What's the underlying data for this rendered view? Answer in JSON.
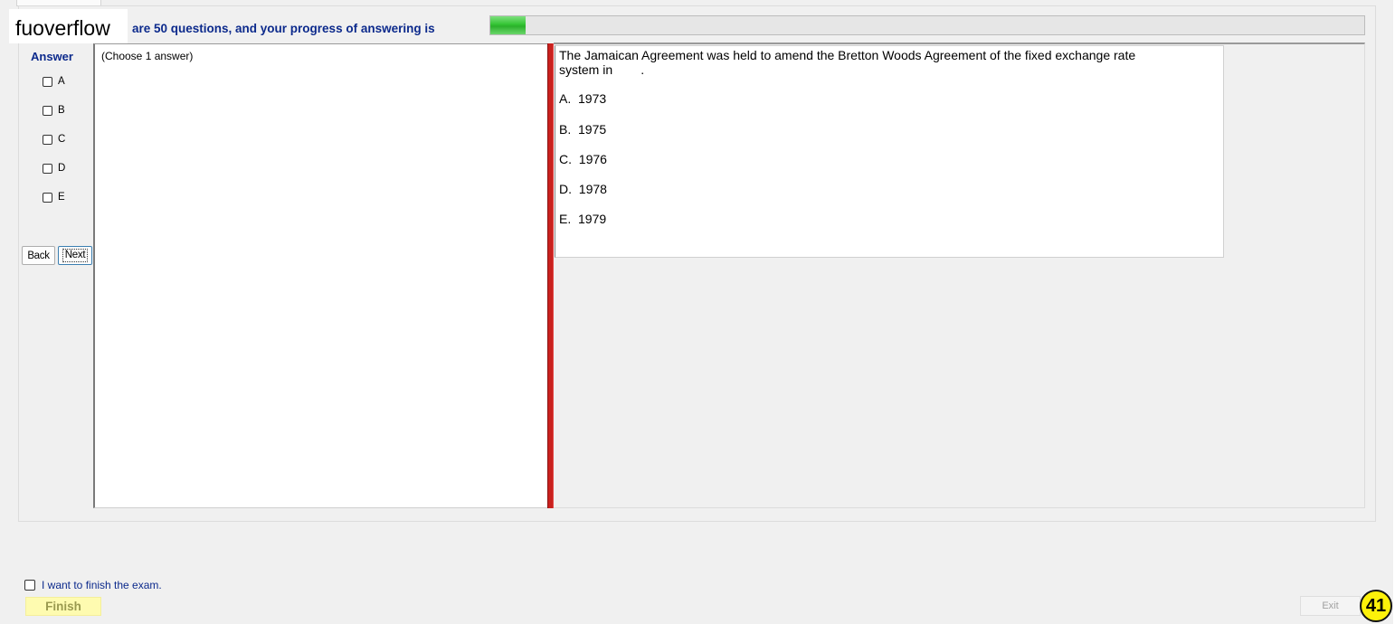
{
  "watermark": "fuoverflow",
  "header": {
    "progress_text": "are 50 questions, and your progress of answering is",
    "progress_fraction": 0.04
  },
  "answer_panel": {
    "title": "Answer",
    "options": [
      "A",
      "B",
      "C",
      "D",
      "E"
    ],
    "back_label": "Back",
    "next_label": "Next",
    "instruction": "(Choose 1 answer)"
  },
  "question": {
    "text_line1": "The Jamaican Agreement was held to amend the Bretton Woods Agreement of the fixed exchange rate",
    "text_line2": "system in        .",
    "choices": [
      "A.  1973",
      "B.  1975",
      "C.  1976",
      "D.  1978",
      "E.  1979"
    ]
  },
  "footer": {
    "finish_check_label": "I want to finish the exam.",
    "finish_label": "Finish",
    "exit_label": "Exit",
    "page_number": "41"
  },
  "colors": {
    "label_blue": "#0c2a8c",
    "splitter_red": "#c9211e",
    "progress_green": "#33c433",
    "finish_bg": "#fefbb0",
    "badge_yellow": "#fdf10a"
  }
}
